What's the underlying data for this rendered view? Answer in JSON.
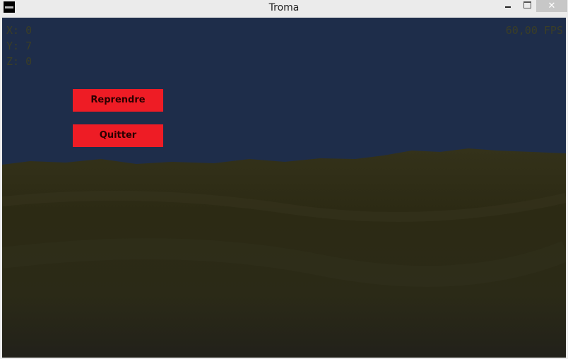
{
  "window": {
    "title": "Troma",
    "app_icon": "console-icon",
    "controls": {
      "minimize": "minimize-icon",
      "maximize": "maximize-icon",
      "close": "✕"
    }
  },
  "hud": {
    "x": "X: 0",
    "y": "Y: 7",
    "z": "Z: 0",
    "fps": "60,00 FPS"
  },
  "menu": {
    "resume": "Reprendre",
    "quit": "Quitter"
  },
  "colors": {
    "sky": "#1e2d4a",
    "terrain": "#2e2c16",
    "button": "#ee1c25",
    "hud_text": "#3b3e26"
  }
}
